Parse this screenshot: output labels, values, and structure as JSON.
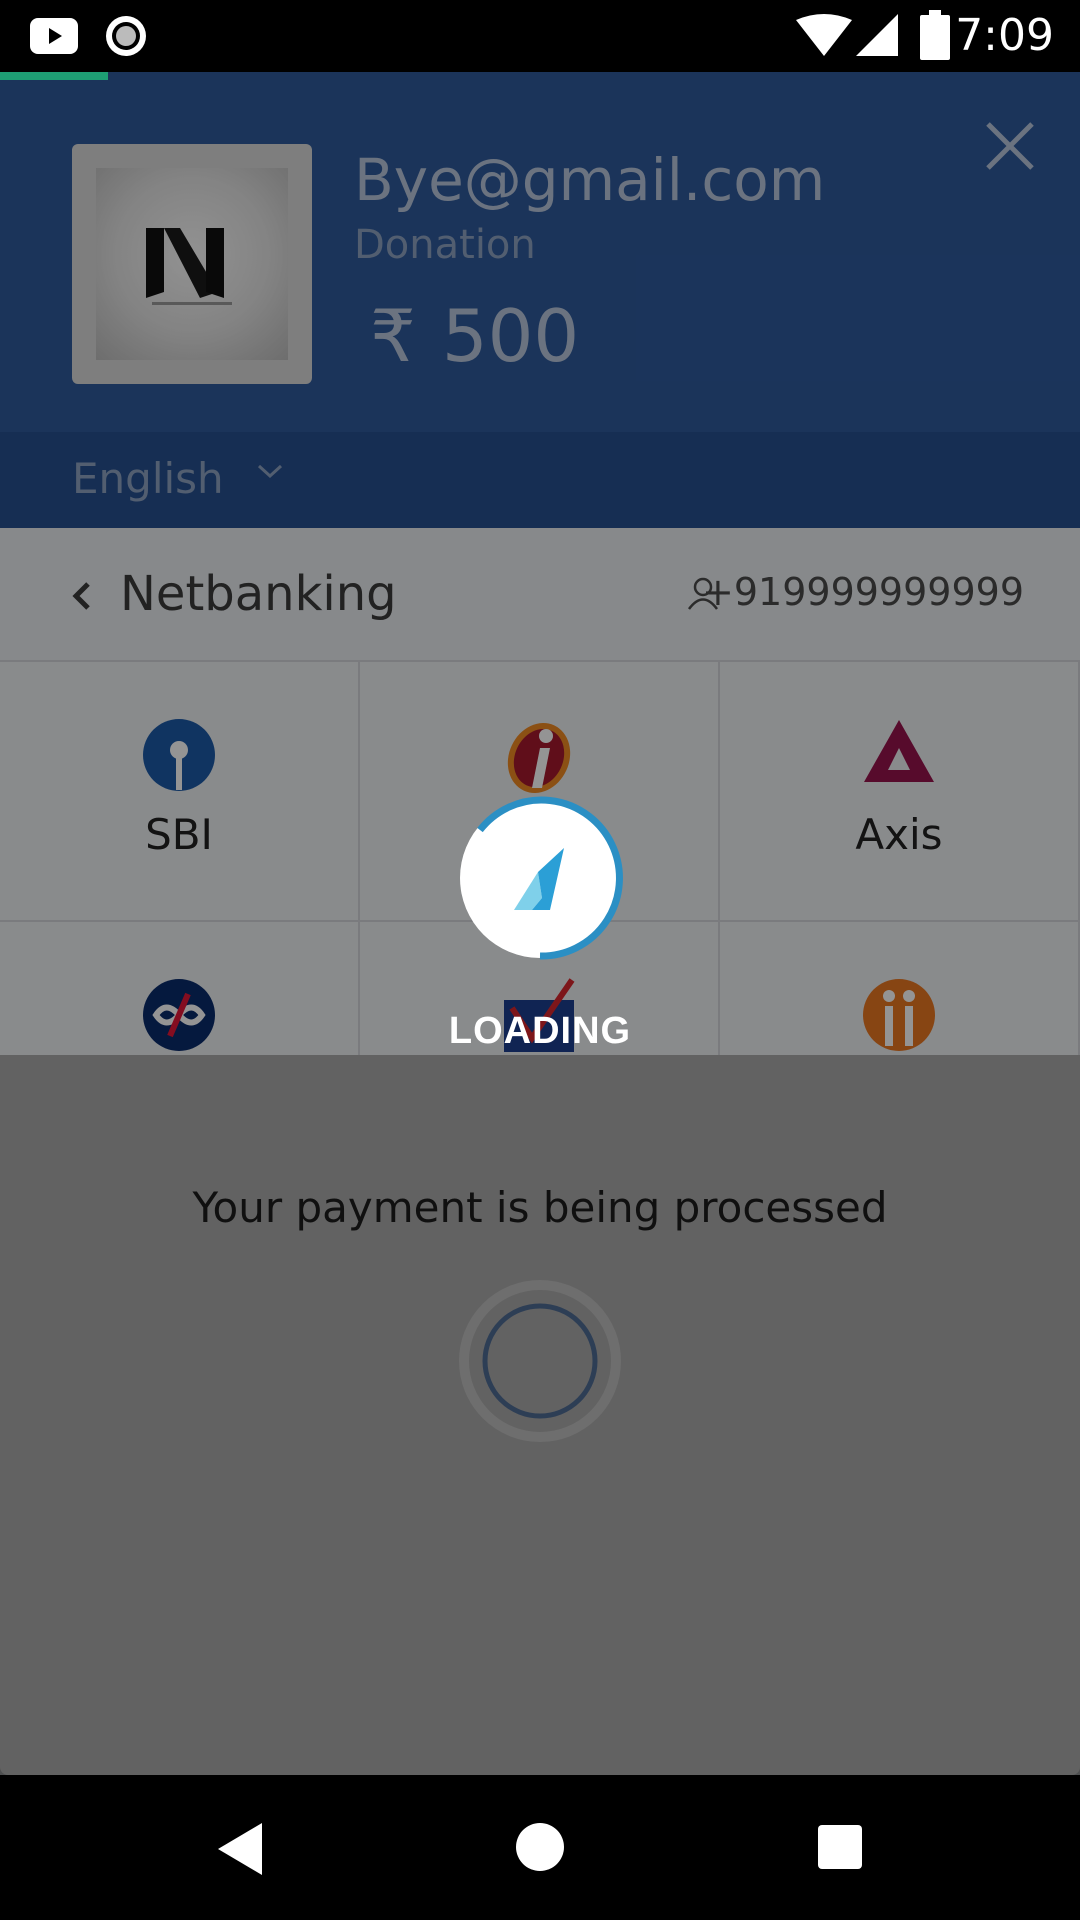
{
  "status_bar": {
    "time": "7:09"
  },
  "header": {
    "merchant_email": "Bye@gmail.com",
    "merchant_description": "Donation",
    "currency_symbol": "₹",
    "amount": "500",
    "language": "English"
  },
  "netbanking": {
    "title": "Netbanking",
    "phone": "+919999999999",
    "banks": [
      {
        "name": "SBI",
        "icon": "sbi-logo-icon"
      },
      {
        "name": "",
        "icon": "icici-logo-icon"
      },
      {
        "name": "Axis",
        "icon": "axis-logo-icon"
      },
      {
        "name": "",
        "icon": "kotak-logo-icon"
      },
      {
        "name": "",
        "icon": "yes-bank-logo-icon"
      },
      {
        "name": "",
        "icon": "idbi-logo-icon"
      }
    ]
  },
  "processing": {
    "message": "Your payment is being processed"
  },
  "loader": {
    "label": "LOADING"
  },
  "colors": {
    "header_bg": "#2f5a9c",
    "accent": "#1e9e74",
    "spinner": "#2b8fc4"
  }
}
